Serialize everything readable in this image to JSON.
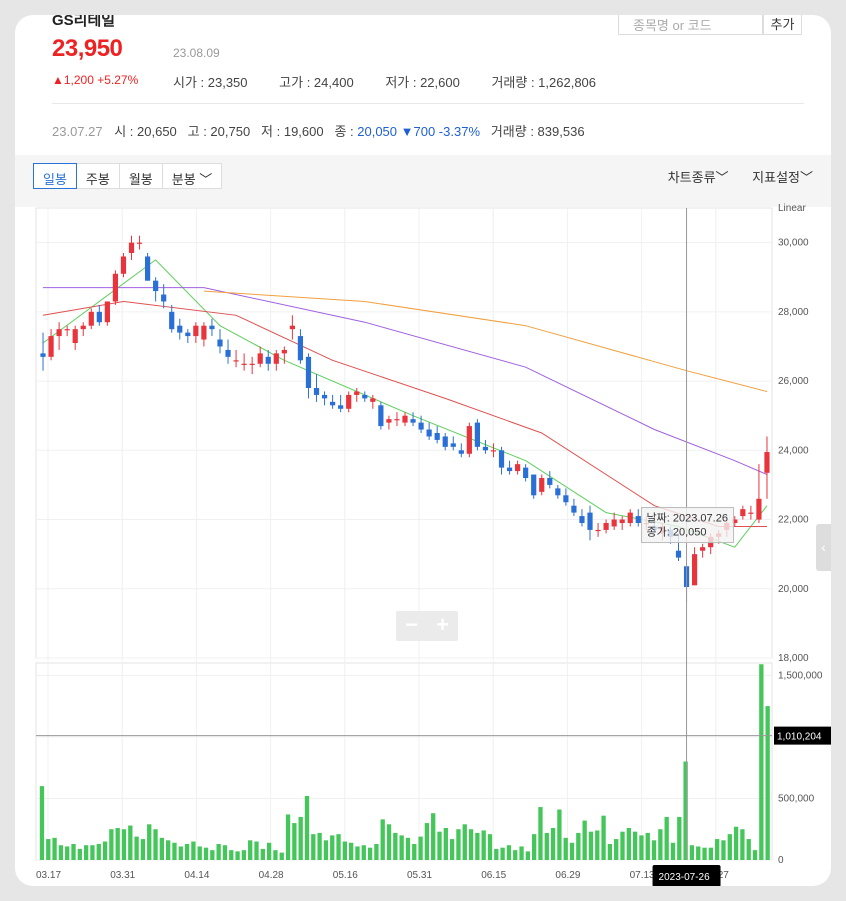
{
  "header": {
    "name": "GS리테일",
    "search_placeholder": "종목명 or 코드",
    "add_label": "추가",
    "price": "23,950",
    "date": "23.08.09",
    "change": "▲1,200 +5.27%",
    "open": "시가 : 23,350",
    "high": "고가 : 24,400",
    "low": "저가 : 22,600",
    "volume": "거래량 : 1,262,806"
  },
  "prev_day": {
    "date": "23.07.27",
    "open": "시 : 20,650",
    "high": "고 : 20,750",
    "low": "저 : 19,600",
    "close_label": "종 : ",
    "close_value": "20,050",
    "change": "▼700 -3.37%",
    "volume": "거래량 : 839,536"
  },
  "toolbar": {
    "tabs": [
      "일봉",
      "주봉",
      "월봉",
      "분봉 ﹀"
    ],
    "chart_type": "차트종류﹀",
    "indicator": "지표설정﹀"
  },
  "tooltip": {
    "date": "날짜: 2023.07.26",
    "close": "종가: 20,050"
  },
  "crosshair": {
    "volume_label": "1,010,204",
    "date_label": "2023-07-26"
  },
  "colors": {
    "up": "#e8343c",
    "down": "#2a6fd6",
    "ma5": "#5ccf5c",
    "ma20": "#e05050",
    "ma60": "#a060e0",
    "ma120": "#f0a040",
    "volume": "#45c65a"
  },
  "chart_data": {
    "type": "candlestick",
    "scale_label": "Linear",
    "price_ylim": [
      18000,
      31000
    ],
    "price_ticks": [
      "18,000",
      "20,000",
      "22,000",
      "24,000",
      "26,000",
      "28,000",
      "30,000"
    ],
    "volume_ylim": [
      0,
      1600000
    ],
    "volume_ticks": [
      "0",
      "500,000",
      "1,000,000",
      "1,500,000"
    ],
    "x_ticks": [
      "03.17",
      "03.31",
      "04.14",
      "04.28",
      "05.16",
      "05.31",
      "06.15",
      "06.29",
      "07.13",
      "07.27"
    ],
    "candles": [
      [
        26800,
        27400,
        26300,
        26700
      ],
      [
        26700,
        27500,
        26600,
        27300
      ],
      [
        27300,
        27700,
        26900,
        27500
      ],
      [
        27500,
        27600,
        27300,
        27500
      ],
      [
        27100,
        27600,
        26900,
        27500
      ],
      [
        27500,
        27700,
        27300,
        27600
      ],
      [
        27600,
        28100,
        27500,
        28000
      ],
      [
        28000,
        28200,
        27600,
        27700
      ],
      [
        27700,
        28300,
        27600,
        28300
      ],
      [
        28300,
        29200,
        28200,
        29100
      ],
      [
        29100,
        29700,
        29000,
        29600
      ],
      [
        29700,
        30200,
        29500,
        30000
      ],
      [
        30000,
        30200,
        29800,
        30000
      ],
      [
        29600,
        29700,
        28900,
        28900
      ],
      [
        28900,
        29000,
        28300,
        28600
      ],
      [
        28500,
        28800,
        28100,
        28300
      ],
      [
        28000,
        28200,
        27400,
        27500
      ],
      [
        27600,
        27800,
        27200,
        27400
      ],
      [
        27400,
        27500,
        27100,
        27300
      ],
      [
        27300,
        27700,
        27100,
        27600
      ],
      [
        27200,
        27700,
        27000,
        27600
      ],
      [
        27600,
        27800,
        27300,
        27500
      ],
      [
        27200,
        27500,
        26800,
        27000
      ],
      [
        26900,
        27200,
        26500,
        26700
      ],
      [
        26600,
        26900,
        26400,
        26600
      ],
      [
        26500,
        26800,
        26300,
        26500
      ],
      [
        26500,
        26700,
        26200,
        26500
      ],
      [
        26500,
        27000,
        26400,
        26800
      ],
      [
        26700,
        26900,
        26300,
        26500
      ],
      [
        26500,
        26900,
        26300,
        26800
      ],
      [
        26800,
        27000,
        26500,
        26900
      ],
      [
        27500,
        27900,
        27200,
        27600
      ],
      [
        27300,
        27500,
        26500,
        26600
      ],
      [
        26700,
        26800,
        25500,
        25800
      ],
      [
        25800,
        26200,
        25400,
        25600
      ],
      [
        25600,
        25700,
        25300,
        25500
      ],
      [
        25400,
        25600,
        25200,
        25300
      ],
      [
        25300,
        25600,
        25100,
        25200
      ],
      [
        25200,
        25700,
        25100,
        25600
      ],
      [
        25600,
        25800,
        25400,
        25700
      ],
      [
        25600,
        25700,
        25400,
        25500
      ],
      [
        25400,
        25600,
        25200,
        25500
      ],
      [
        25300,
        25400,
        24600,
        24700
      ],
      [
        24800,
        25000,
        24600,
        24900
      ],
      [
        24900,
        25100,
        24700,
        24900
      ],
      [
        24800,
        25100,
        24700,
        25000
      ],
      [
        24900,
        25100,
        24700,
        24800
      ],
      [
        24800,
        25000,
        24500,
        24600
      ],
      [
        24600,
        24800,
        24300,
        24400
      ],
      [
        24500,
        24700,
        24200,
        24300
      ],
      [
        24400,
        24500,
        24000,
        24100
      ],
      [
        24200,
        24400,
        24000,
        24100
      ],
      [
        24000,
        24200,
        23800,
        23900
      ],
      [
        23900,
        24800,
        23800,
        24700
      ],
      [
        24800,
        24900,
        24000,
        24100
      ],
      [
        24100,
        24300,
        23900,
        24000
      ],
      [
        24000,
        24200,
        23800,
        24000
      ],
      [
        24000,
        24100,
        23300,
        23500
      ],
      [
        23500,
        23700,
        23300,
        23400
      ],
      [
        23400,
        23700,
        23300,
        23600
      ],
      [
        23500,
        23600,
        23100,
        23200
      ],
      [
        23300,
        23300,
        22600,
        22700
      ],
      [
        22800,
        23300,
        22700,
        23200
      ],
      [
        23200,
        23400,
        22900,
        23000
      ],
      [
        22900,
        23000,
        22600,
        22700
      ],
      [
        22700,
        22900,
        22400,
        22500
      ],
      [
        22400,
        22600,
        22100,
        22200
      ],
      [
        22100,
        22300,
        21800,
        21900
      ],
      [
        22200,
        22400,
        21400,
        21700
      ],
      [
        21700,
        21900,
        21500,
        21700
      ],
      [
        21700,
        22000,
        21600,
        21900
      ],
      [
        21800,
        22200,
        21700,
        22000
      ],
      [
        21900,
        22100,
        21700,
        22000
      ],
      [
        21900,
        22300,
        21800,
        22200
      ],
      [
        22100,
        22300,
        21800,
        21900
      ],
      [
        21900,
        22100,
        21700,
        21900
      ],
      [
        21800,
        22000,
        21600,
        21700
      ],
      [
        21600,
        21900,
        21400,
        21800
      ],
      [
        21700,
        21800,
        21300,
        21500
      ],
      [
        21100,
        21600,
        20800,
        20900
      ],
      [
        20650,
        20750,
        19600,
        20050
      ],
      [
        20100,
        21200,
        20100,
        21000
      ],
      [
        21100,
        21300,
        20900,
        21200
      ],
      [
        21200,
        21600,
        21000,
        21500
      ],
      [
        21500,
        21700,
        21300,
        21600
      ],
      [
        21700,
        22000,
        21500,
        21900
      ],
      [
        21900,
        22100,
        21800,
        22000
      ],
      [
        22100,
        22400,
        22000,
        22300
      ],
      [
        22200,
        22400,
        22000,
        22200
      ],
      [
        22000,
        23600,
        21900,
        22600
      ],
      [
        23350,
        24400,
        22600,
        23950
      ]
    ],
    "volume": [
      600000,
      170000,
      180000,
      120000,
      110000,
      130000,
      90000,
      120000,
      120000,
      130000,
      150000,
      250000,
      260000,
      250000,
      280000,
      190000,
      170000,
      290000,
      250000,
      180000,
      160000,
      140000,
      110000,
      130000,
      150000,
      110000,
      100000,
      80000,
      130000,
      120000,
      80000,
      70000,
      80000,
      160000,
      150000,
      90000,
      140000,
      80000,
      60000,
      370000,
      300000,
      350000,
      520000,
      210000,
      220000,
      160000,
      200000,
      210000,
      150000,
      140000,
      110000,
      120000,
      100000,
      130000,
      330000,
      290000,
      220000,
      200000,
      180000,
      130000,
      190000,
      300000,
      380000,
      230000,
      260000,
      170000,
      250000,
      290000,
      250000,
      220000,
      240000,
      210000,
      90000,
      100000,
      120000,
      80000,
      110000,
      70000,
      210000,
      430000,
      220000,
      260000,
      410000,
      180000,
      140000,
      220000,
      320000,
      230000,
      240000,
      360000,
      130000,
      170000,
      230000,
      260000,
      230000,
      200000,
      220000,
      160000,
      250000,
      350000,
      140000,
      350000,
      800000,
      120000,
      110000,
      100000,
      100000,
      170000,
      160000,
      210000,
      270000,
      250000,
      170000,
      80000,
      1590000,
      1250000
    ],
    "ma_series": [
      {
        "name": "MA5",
        "values": [
          [
            0,
            27100
          ],
          [
            14,
            29500
          ],
          [
            22,
            27600
          ],
          [
            30,
            26600
          ],
          [
            46,
            25000
          ],
          [
            60,
            23700
          ],
          [
            70,
            22200
          ],
          [
            79,
            21800
          ],
          [
            86,
            21200
          ],
          [
            90,
            22400
          ]
        ]
      },
      {
        "name": "MA20",
        "values": [
          [
            0,
            27900
          ],
          [
            10,
            28300
          ],
          [
            24,
            27900
          ],
          [
            36,
            26600
          ],
          [
            50,
            25500
          ],
          [
            62,
            24500
          ],
          [
            76,
            22400
          ],
          [
            84,
            21800
          ],
          [
            90,
            21800
          ]
        ]
      },
      {
        "name": "MA60",
        "values": [
          [
            0,
            28700
          ],
          [
            20,
            28700
          ],
          [
            40,
            27700
          ],
          [
            60,
            26400
          ],
          [
            76,
            24600
          ],
          [
            86,
            23700
          ],
          [
            90,
            23300
          ]
        ]
      },
      {
        "name": "MA120",
        "values": [
          [
            20,
            28600
          ],
          [
            40,
            28300
          ],
          [
            60,
            27600
          ],
          [
            80,
            26300
          ],
          [
            90,
            25700
          ]
        ]
      }
    ]
  }
}
